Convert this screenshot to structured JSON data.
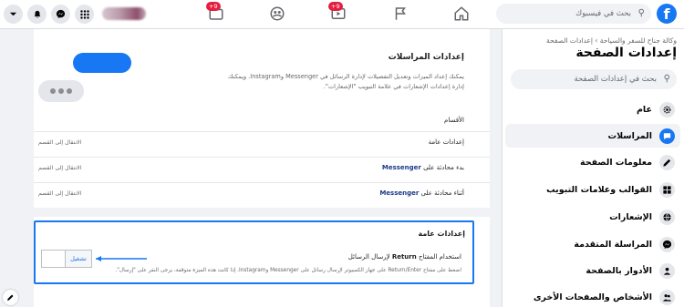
{
  "topbar": {
    "logo": "f",
    "search_placeholder": "بحث في فيسبوك",
    "nav_badges": {
      "watch": "+9",
      "pages": "+9"
    },
    "icons": [
      "home-icon",
      "flag-icon",
      "watch-icon",
      "groups-icon",
      "gaming-icon",
      "menu-grid-icon",
      "messenger-icon",
      "bell-icon",
      "chevron-down-icon"
    ]
  },
  "sidebar": {
    "breadcrumb": "وكالة جناح للسفر والسياحة › إعدادات الصفحة",
    "title": "إعدادات الصفحة",
    "search_placeholder": "بحث في إعدادات الصفحة",
    "items": [
      {
        "label": "عام",
        "icon": "gear-icon",
        "active": false
      },
      {
        "label": "المراسلات",
        "icon": "chat-icon",
        "active": true
      },
      {
        "label": "معلومات الصفحة",
        "icon": "pencil-icon",
        "active": false
      },
      {
        "label": "القوالب وعلامات التبويب",
        "icon": "grid-icon",
        "active": false
      },
      {
        "label": "الإشعارات",
        "icon": "globe-icon",
        "active": false
      },
      {
        "label": "المراسلة المتقدمة",
        "icon": "messenger-icon",
        "active": false
      },
      {
        "label": "الأدوار بالصفحة",
        "icon": "person-icon",
        "active": false
      },
      {
        "label": "الأشخاص والصفحات الأخرى",
        "icon": "people-icon",
        "active": false
      }
    ]
  },
  "main": {
    "title": "إعدادات المراسلات",
    "description": "يمكنك إعداد الميزات وتعديل التفضيلات لإدارة الرسائل في Messenger وInstagram. ويمكنك إدارة إعدادات الإشعارات في علامة التبويب \"الإشعارات\".",
    "sections_label": "الأقسام",
    "rows": [
      {
        "label": "إعدادات عامة",
        "bold": "",
        "action": "الانتقال إلى القسم"
      },
      {
        "label": "بدء محادثة على ",
        "bold": "Messenger",
        "action": "الانتقال إلى القسم"
      },
      {
        "label": "أثناء محادثة على ",
        "bold": "Messenger",
        "action": "الانتقال إلى القسم"
      }
    ],
    "general": {
      "title": "إعدادات عامة",
      "setting_prefix": "استخدام المفتاح ",
      "setting_bold": "Return",
      "setting_suffix": " لإرسال الرسائل",
      "help": "اضغط على مفتاح Return/Enter على جهاز الكمبيوتر لإرسال رسائل على Messenger وInstagram. إذا كانت هذه الميزة متوقفة، يرجى النقر على \"إرسال\".",
      "toggle_label": "تشغيل"
    }
  },
  "colors": {
    "accent": "#1877f2",
    "badge": "#e41e3f",
    "background": "#f0f2f5"
  }
}
